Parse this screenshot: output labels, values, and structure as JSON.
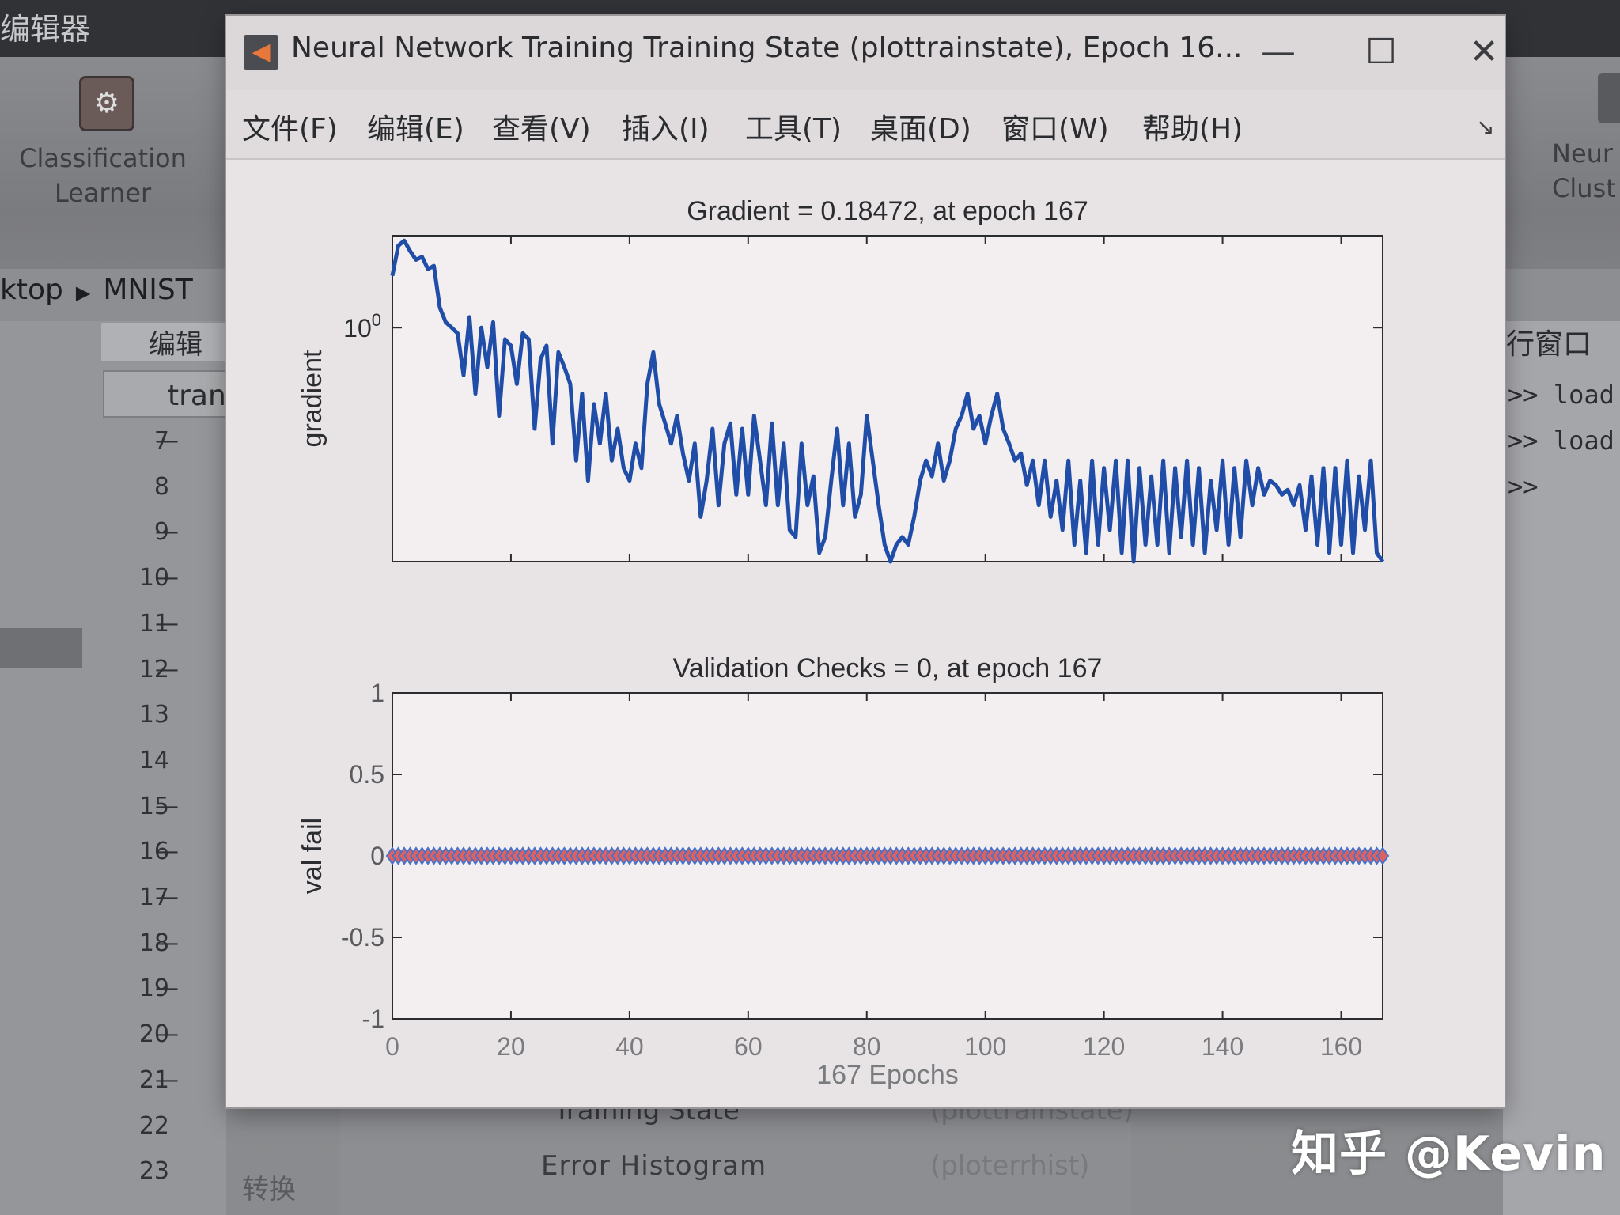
{
  "background": {
    "top_title": "编辑器",
    "toolstrip": {
      "classification_learner": {
        "icon": "classification-learner-icon",
        "label_line1": "Classification",
        "label_line2": "Learner"
      },
      "neural_clustering": {
        "icon": "neural-clustering-icon",
        "label_line1": "Neur",
        "label_line2": "Clust"
      }
    },
    "path": {
      "part1": "ktop",
      "part2": "MNIST"
    },
    "editor": {
      "tab_label": "编辑器",
      "file_tab": "tran",
      "line_numbers": [
        "7",
        "8",
        "9",
        "10",
        "11",
        "12",
        "13",
        "14",
        "15",
        "16",
        "17",
        "18",
        "19",
        "20",
        "21",
        "22",
        "23"
      ]
    },
    "command_window": {
      "title": "行窗口",
      "lines": [
        ">> load",
        ">> load",
        ">>"
      ]
    },
    "table": {
      "row1_col1": "Training State",
      "row1_col2": "(plottrainstate)",
      "row2_col1": "Error Histogram",
      "row2_col2": "(ploterrhist)"
    },
    "convert_label": "转换",
    "watermark": "知乎 @Kevin"
  },
  "window": {
    "title": "Neural Network Training Training State (plottrainstate), Epoch 16...",
    "minimize_label": "—",
    "maximize_label": "☐",
    "close_label": "✕",
    "menus": [
      "文件(F)",
      "编辑(E)",
      "查看(V)",
      "插入(I)",
      "工具(T)",
      "桌面(D)",
      "窗口(W)",
      "帮助(H)"
    ],
    "colors": {
      "line": "#1f4da8",
      "marker_fill": "#e06060",
      "marker_edge": "#4a73c8"
    }
  },
  "chart_data": [
    {
      "type": "line",
      "title": "Gradient = 0.18472, at epoch 167",
      "ylabel": "gradient",
      "xlabel": "",
      "yscale": "log",
      "xlim": [
        0,
        167
      ],
      "ylim": [
        0.12,
        2.3
      ],
      "y_tick_label": "10",
      "y_tick_exponent": "0",
      "x": [
        0,
        1,
        2,
        3,
        4,
        5,
        6,
        7,
        8,
        9,
        10,
        11,
        12,
        13,
        14,
        15,
        16,
        17,
        18,
        19,
        20,
        21,
        22,
        23,
        24,
        25,
        26,
        27,
        28,
        29,
        30,
        31,
        32,
        33,
        34,
        35,
        36,
        37,
        38,
        39,
        40,
        41,
        42,
        43,
        44,
        45,
        46,
        47,
        48,
        49,
        50,
        51,
        52,
        53,
        54,
        55,
        56,
        57,
        58,
        59,
        60,
        61,
        62,
        63,
        64,
        65,
        66,
        67,
        68,
        69,
        70,
        71,
        72,
        73,
        74,
        75,
        76,
        77,
        78,
        79,
        80,
        81,
        82,
        83,
        84,
        85,
        86,
        87,
        88,
        89,
        90,
        91,
        92,
        93,
        94,
        95,
        96,
        97,
        98,
        99,
        100,
        101,
        102,
        103,
        104,
        105,
        106,
        107,
        108,
        109,
        110,
        111,
        112,
        113,
        114,
        115,
        116,
        117,
        118,
        119,
        120,
        121,
        122,
        123,
        124,
        125,
        126,
        127,
        128,
        129,
        130,
        131,
        132,
        133,
        134,
        135,
        136,
        137,
        138,
        139,
        140,
        141,
        142,
        143,
        144,
        145,
        146,
        147,
        148,
        149,
        150,
        151,
        152,
        153,
        154,
        155,
        156,
        157,
        158,
        159,
        160,
        161,
        162,
        163,
        164,
        165,
        166,
        167
      ],
      "series": [
        {
          "name": "",
          "values": [
            1.6,
            2.1,
            2.2,
            2.0,
            1.85,
            1.9,
            1.7,
            1.75,
            1.2,
            1.05,
            1.0,
            0.95,
            0.65,
            1.1,
            0.55,
            1.0,
            0.7,
            1.05,
            0.45,
            0.9,
            0.85,
            0.6,
            0.95,
            0.9,
            0.4,
            0.75,
            0.85,
            0.35,
            0.8,
            0.7,
            0.6,
            0.3,
            0.55,
            0.25,
            0.5,
            0.35,
            0.55,
            0.3,
            0.4,
            0.28,
            0.25,
            0.35,
            0.28,
            0.6,
            0.8,
            0.5,
            0.42,
            0.35,
            0.45,
            0.32,
            0.25,
            0.35,
            0.18,
            0.25,
            0.4,
            0.2,
            0.35,
            0.42,
            0.22,
            0.4,
            0.22,
            0.45,
            0.3,
            0.2,
            0.42,
            0.2,
            0.35,
            0.16,
            0.15,
            0.35,
            0.2,
            0.26,
            0.13,
            0.15,
            0.25,
            0.4,
            0.2,
            0.35,
            0.18,
            0.22,
            0.45,
            0.3,
            0.2,
            0.14,
            0.12,
            0.14,
            0.15,
            0.14,
            0.18,
            0.25,
            0.3,
            0.26,
            0.35,
            0.25,
            0.3,
            0.4,
            0.45,
            0.55,
            0.4,
            0.45,
            0.35,
            0.45,
            0.55,
            0.4,
            0.35,
            0.3,
            0.32,
            0.24,
            0.3,
            0.2,
            0.3,
            0.18,
            0.25,
            0.16,
            0.3,
            0.14,
            0.25,
            0.13,
            0.3,
            0.14,
            0.28,
            0.16,
            0.3,
            0.13,
            0.3,
            0.12,
            0.28,
            0.14,
            0.26,
            0.14,
            0.3,
            0.13,
            0.28,
            0.15,
            0.3,
            0.14,
            0.28,
            0.13,
            0.25,
            0.16,
            0.3,
            0.14,
            0.28,
            0.15,
            0.3,
            0.2,
            0.28,
            0.22,
            0.25,
            0.24,
            0.22,
            0.23,
            0.2,
            0.24,
            0.16,
            0.26,
            0.14,
            0.28,
            0.13,
            0.28,
            0.14,
            0.3,
            0.13,
            0.26,
            0.16,
            0.3,
            0.13,
            0.12
          ]
        }
      ]
    },
    {
      "type": "scatter",
      "title": "Validation Checks = 0, at epoch 167",
      "ylabel": "val fail",
      "xlabel": "167 Epochs",
      "xlim": [
        0,
        167
      ],
      "ylim": [
        -1,
        1
      ],
      "x_ticks": [
        0,
        20,
        40,
        60,
        80,
        100,
        120,
        140,
        160
      ],
      "y_ticks": [
        -1,
        -0.5,
        0,
        0.5,
        1
      ],
      "marker": "diamond",
      "series": [
        {
          "name": "",
          "value": 0,
          "epochs": 168
        }
      ]
    }
  ]
}
